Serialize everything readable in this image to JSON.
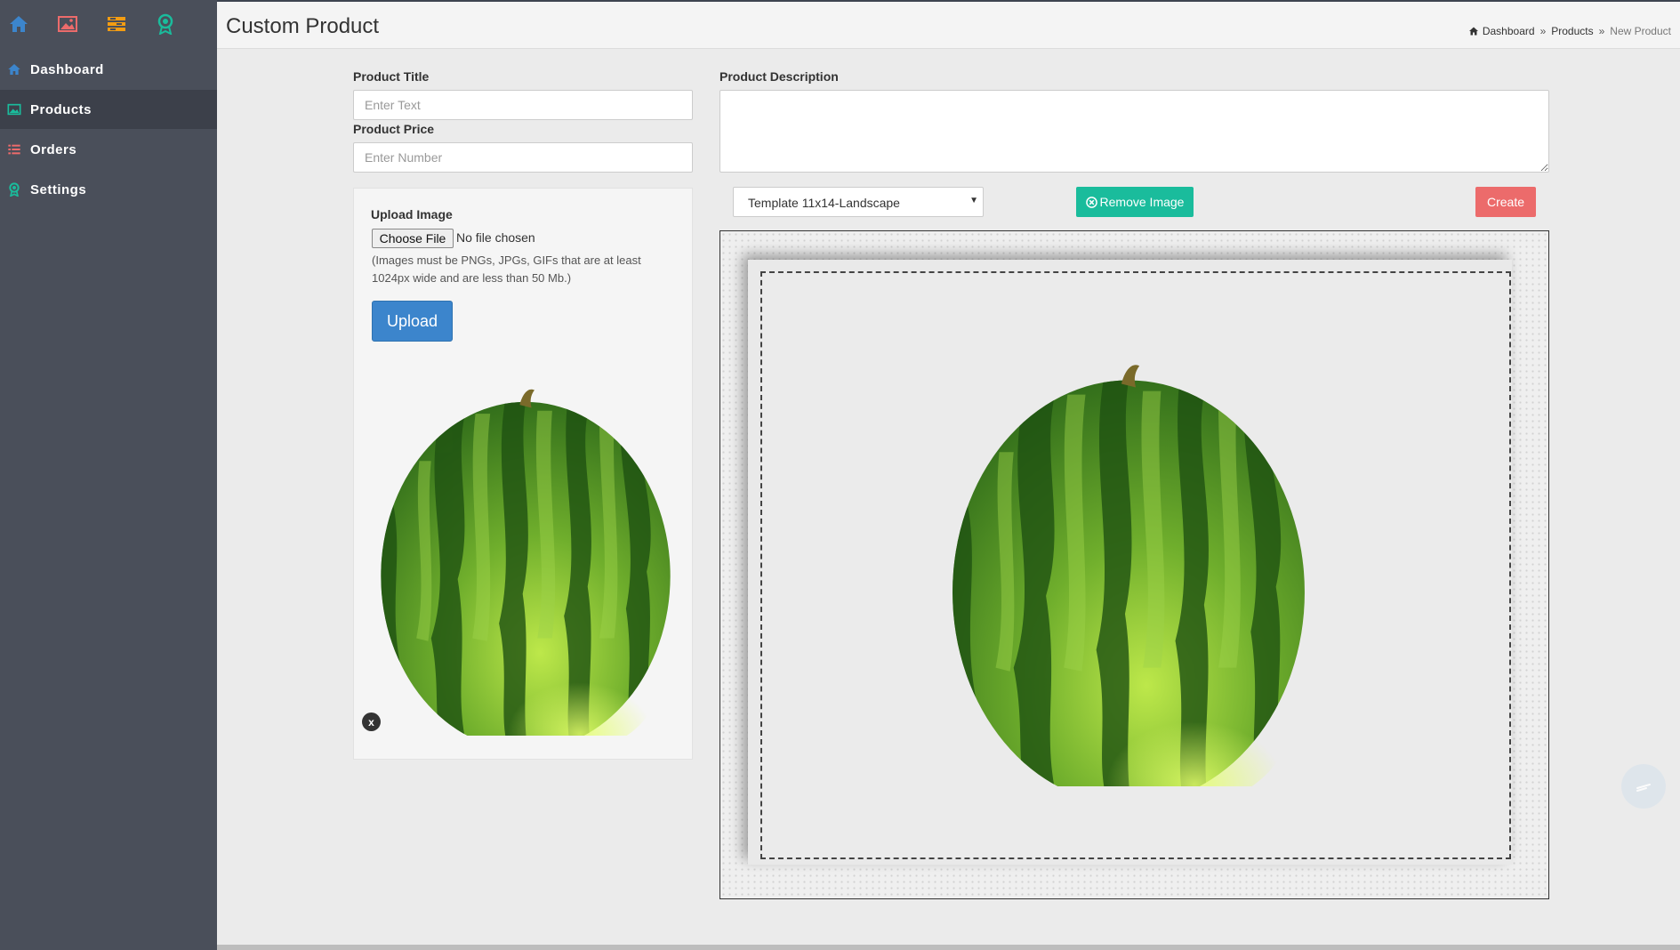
{
  "sidebar": {
    "top_icons": [
      "home-icon",
      "image-icon",
      "list-icon",
      "badge-icon"
    ],
    "items": [
      {
        "label": "Dashboard",
        "icon": "home-icon",
        "color": "#3c85cc"
      },
      {
        "label": "Products",
        "icon": "image-icon",
        "color": "#1abc9c",
        "active": true
      },
      {
        "label": "Orders",
        "icon": "list-icon",
        "color": "#ec6b6b"
      },
      {
        "label": "Settings",
        "icon": "badge-icon",
        "color": "#1abc9c"
      }
    ]
  },
  "header": {
    "title": "Custom Product",
    "breadcrumb": [
      "Dashboard",
      "Products",
      "New Product"
    ]
  },
  "form": {
    "title_label": "Product Title",
    "title_placeholder": "Enter Text",
    "price_label": "Product Price",
    "price_placeholder": "Enter Number",
    "description_label": "Product Description",
    "description_value": ""
  },
  "upload": {
    "label": "Upload Image",
    "choose_label": "Choose File",
    "file_status": "No file chosen",
    "hint": "(Images must be PNGs, JPGs, GIFs that are at least 1024px wide and are less than 50 Mb.)",
    "button_label": "Upload",
    "remove_label": "x",
    "preview": "watermelon"
  },
  "toolbar": {
    "template_selected": "Template 11x14-Landscape",
    "remove_image_label": "Remove Image",
    "create_label": "Create"
  },
  "colors": {
    "accent_blue": "#3c85cc",
    "accent_teal": "#1abc9c",
    "accent_red": "#ec6b6b",
    "sidebar_bg": "#4a4f5a",
    "orders_icon": "#f39c12"
  }
}
